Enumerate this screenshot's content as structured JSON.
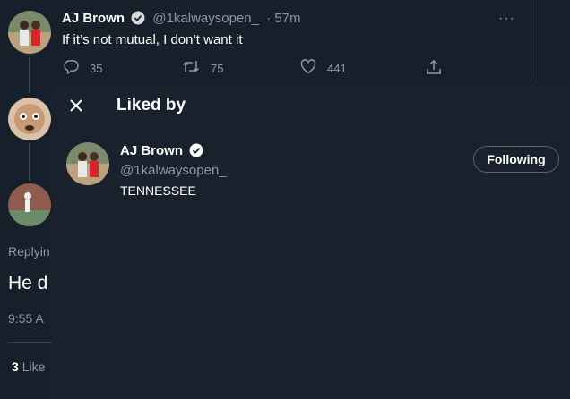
{
  "tweet": {
    "author_name": "AJ Brown",
    "author_handle": "@1kalwaysopen_",
    "time": "· 57m",
    "text": "If it’s not mutual, I don’t want it",
    "more": "···",
    "replies": "35",
    "retweets": "75",
    "likes": "441"
  },
  "background_thread": {
    "replying_partial": "Replyin",
    "big_text_partial": "He d",
    "timestamp_partial": "9:55 A",
    "likes_count": "3",
    "likes_label_partial": "Like"
  },
  "modal": {
    "title": "Liked by",
    "user": {
      "name": "AJ Brown",
      "handle": "@1kalwaysopen_",
      "bio": "TENNESSEE",
      "button_label": "Following"
    }
  },
  "colors": {
    "background": "#15202b",
    "modal_background": "#18212c",
    "muted_text": "#8b98a5",
    "divider": "#38444d"
  },
  "icons": {
    "verified": "verified-badge-icon",
    "reply": "reply-icon",
    "retweet": "retweet-icon",
    "like": "heart-icon",
    "share": "share-icon",
    "close": "close-icon"
  }
}
